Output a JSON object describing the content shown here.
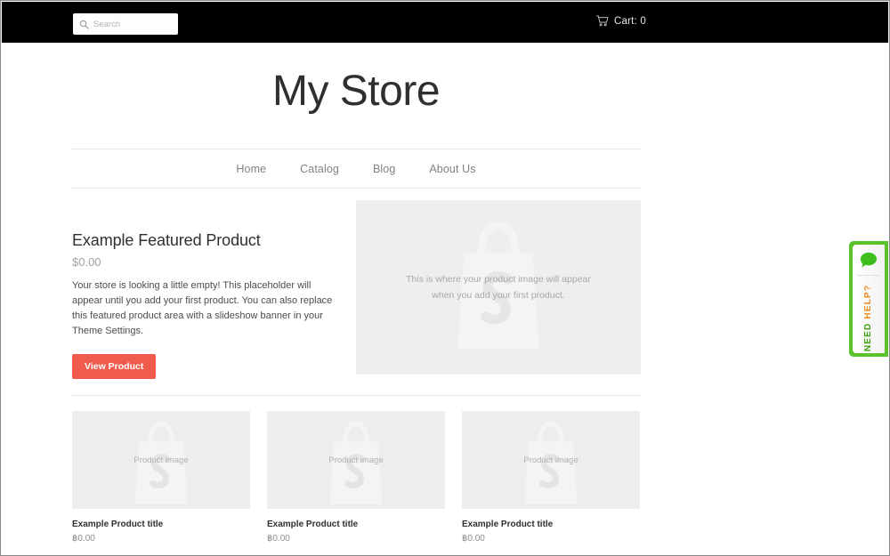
{
  "topbar": {
    "search": {
      "placeholder": "Search",
      "value": "",
      "icon": "search-icon"
    },
    "cart": {
      "label": "Cart: 0",
      "icon": "shopping-cart-icon"
    }
  },
  "header": {
    "store_title": "My Store"
  },
  "nav": {
    "items": [
      {
        "label": "Home"
      },
      {
        "label": "Catalog"
      },
      {
        "label": "Blog"
      },
      {
        "label": "About Us"
      }
    ]
  },
  "featured": {
    "title": "Example Featured Product",
    "price": "$0.00",
    "description": "Your store is looking a little empty! This placeholder will appear until you add your first product. You can also replace this featured product area with a slideshow banner in your Theme Settings.",
    "button_label": "View Product",
    "image_placeholder_line1": "This is where your product image will appear",
    "image_placeholder_line2": "when you add your first product.",
    "image_watermark": "shopify-bag-icon"
  },
  "products": [
    {
      "image_label": "Product image",
      "title": "Example Product title",
      "price": "฿0.00"
    },
    {
      "image_label": "Product image",
      "title": "Example Product title",
      "price": "฿0.00"
    },
    {
      "image_label": "Product image",
      "title": "Example Product title",
      "price": "฿0.00"
    }
  ],
  "help_tab": {
    "word_need": "NEED",
    "word_help": "HELP?",
    "icon": "chat-bubble-icon"
  },
  "colors": {
    "topbar_bg": "#000000",
    "button_accent": "#ef5b4d",
    "help_green": "#5cc22b",
    "help_text_green": "#3fa014",
    "help_text_orange": "#f08a1e",
    "placeholder_bg": "#eeeeee",
    "text_dark": "#2f2f2f",
    "text_muted": "#a3a3a3"
  }
}
